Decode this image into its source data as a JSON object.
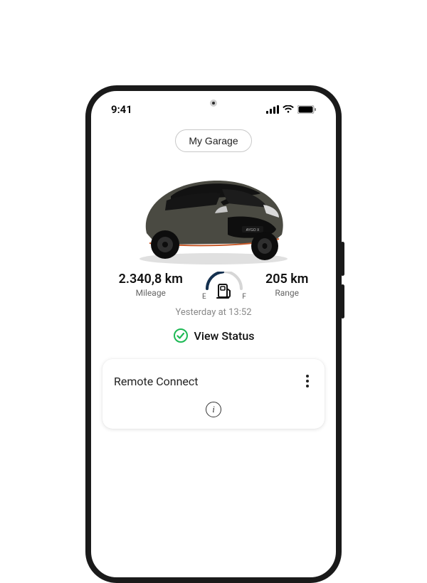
{
  "status_bar": {
    "time": "9:41"
  },
  "garage_button_label": "My Garage",
  "vehicle_model_plate": "AYGO X",
  "mileage": {
    "value": "2.340,8 km",
    "label": "Mileage"
  },
  "range": {
    "value": "205 km",
    "label": "Range"
  },
  "fuel_gauge": {
    "empty_label": "E",
    "full_label": "F",
    "level_fraction": 0.45
  },
  "last_update": "Yesterday at 13:52",
  "view_status_label": "View Status",
  "remote_connect_card": {
    "title": "Remote Connect"
  },
  "colors": {
    "status_ok": "#1db954",
    "car_body": "#4a4a42",
    "car_roof": "#121212",
    "accent_line": "#c85a2a"
  }
}
